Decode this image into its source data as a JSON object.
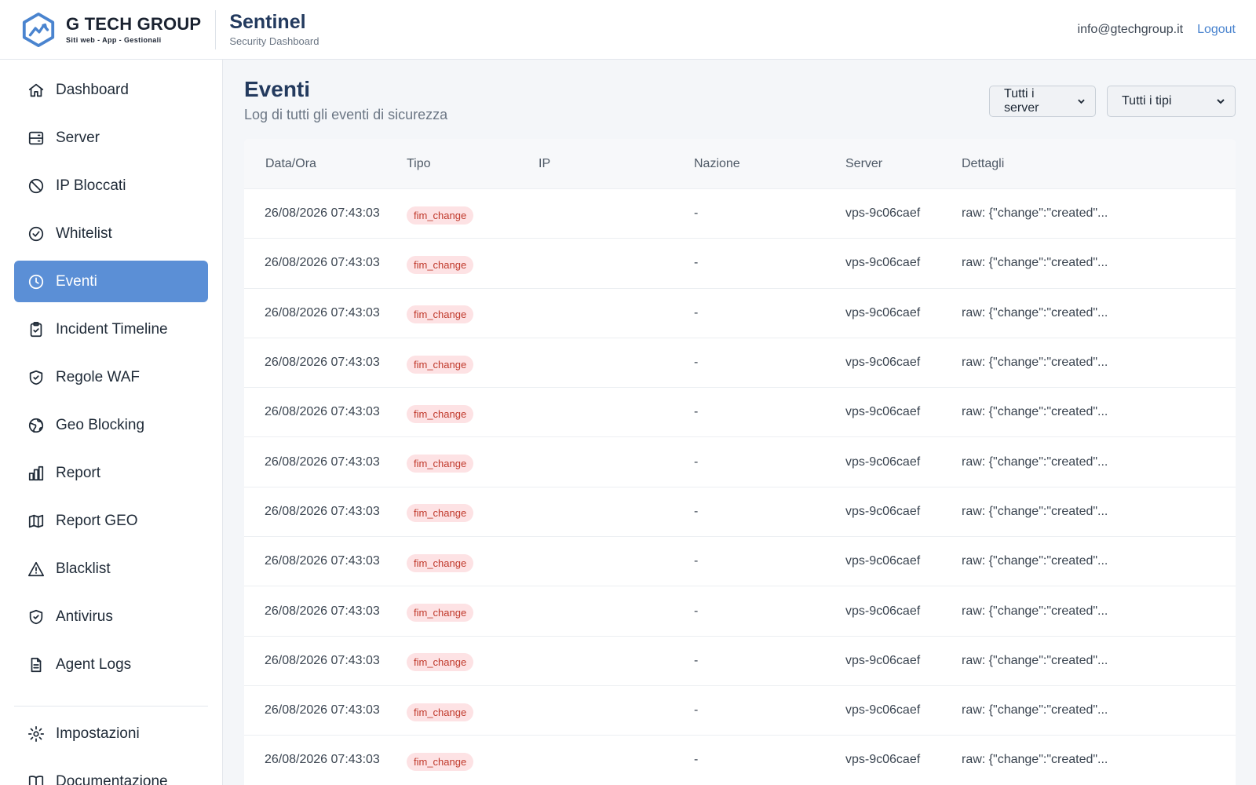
{
  "header": {
    "brand_name": "G TECH GROUP",
    "brand_tagline": "Siti web - App - Gestionali",
    "app_title": "Sentinel",
    "app_subtitle": "Security Dashboard",
    "user_email": "info@gtechgroup.it",
    "logout_label": "Logout"
  },
  "sidebar": {
    "items": [
      {
        "label": "Dashboard",
        "icon": "home-icon"
      },
      {
        "label": "Server",
        "icon": "server-icon"
      },
      {
        "label": "IP Bloccati",
        "icon": "ban-icon"
      },
      {
        "label": "Whitelist",
        "icon": "check-circle-icon"
      },
      {
        "label": "Eventi",
        "icon": "clock-icon",
        "active": true
      },
      {
        "label": "Incident Timeline",
        "icon": "clipboard-check-icon"
      },
      {
        "label": "Regole WAF",
        "icon": "shield-check-icon"
      },
      {
        "label": "Geo Blocking",
        "icon": "globe-icon"
      },
      {
        "label": "Report",
        "icon": "bar-chart-icon"
      },
      {
        "label": "Report GEO",
        "icon": "map-icon"
      },
      {
        "label": "Blacklist",
        "icon": "warning-icon"
      },
      {
        "label": "Antivirus",
        "icon": "shield-check-icon"
      },
      {
        "label": "Agent Logs",
        "icon": "document-icon"
      }
    ],
    "bottom_items": [
      {
        "label": "Impostazioni",
        "icon": "gear-icon"
      },
      {
        "label": "Documentazione",
        "icon": "book-icon"
      }
    ]
  },
  "page": {
    "title": "Eventi",
    "subtitle": "Log di tutti gli eventi di sicurezza",
    "filter_server": "Tutti i server",
    "filter_type": "Tutti i tipi"
  },
  "table": {
    "headers": {
      "date": "Data/Ora",
      "type": "Tipo",
      "ip": "IP",
      "nation": "Nazione",
      "server": "Server",
      "details": "Dettagli"
    },
    "rows": [
      {
        "date": "26/08/2026 07:43:03",
        "type": "fim_change",
        "ip": "",
        "nation": "-",
        "server": "vps-9c06caef",
        "details": "raw: {\"change\":\"created\"..."
      },
      {
        "date": "26/08/2026 07:43:03",
        "type": "fim_change",
        "ip": "",
        "nation": "-",
        "server": "vps-9c06caef",
        "details": "raw: {\"change\":\"created\"..."
      },
      {
        "date": "26/08/2026 07:43:03",
        "type": "fim_change",
        "ip": "",
        "nation": "-",
        "server": "vps-9c06caef",
        "details": "raw: {\"change\":\"created\"..."
      },
      {
        "date": "26/08/2026 07:43:03",
        "type": "fim_change",
        "ip": "",
        "nation": "-",
        "server": "vps-9c06caef",
        "details": "raw: {\"change\":\"created\"..."
      },
      {
        "date": "26/08/2026 07:43:03",
        "type": "fim_change",
        "ip": "",
        "nation": "-",
        "server": "vps-9c06caef",
        "details": "raw: {\"change\":\"created\"..."
      },
      {
        "date": "26/08/2026 07:43:03",
        "type": "fim_change",
        "ip": "",
        "nation": "-",
        "server": "vps-9c06caef",
        "details": "raw: {\"change\":\"created\"..."
      },
      {
        "date": "26/08/2026 07:43:03",
        "type": "fim_change",
        "ip": "",
        "nation": "-",
        "server": "vps-9c06caef",
        "details": "raw: {\"change\":\"created\"..."
      },
      {
        "date": "26/08/2026 07:43:03",
        "type": "fim_change",
        "ip": "",
        "nation": "-",
        "server": "vps-9c06caef",
        "details": "raw: {\"change\":\"created\"..."
      },
      {
        "date": "26/08/2026 07:43:03",
        "type": "fim_change",
        "ip": "",
        "nation": "-",
        "server": "vps-9c06caef",
        "details": "raw: {\"change\":\"created\"..."
      },
      {
        "date": "26/08/2026 07:43:03",
        "type": "fim_change",
        "ip": "",
        "nation": "-",
        "server": "vps-9c06caef",
        "details": "raw: {\"change\":\"created\"..."
      },
      {
        "date": "26/08/2026 07:43:03",
        "type": "fim_change",
        "ip": "",
        "nation": "-",
        "server": "vps-9c06caef",
        "details": "raw: {\"change\":\"created\"..."
      },
      {
        "date": "26/08/2026 07:43:03",
        "type": "fim_change",
        "ip": "",
        "nation": "-",
        "server": "vps-9c06caef",
        "details": "raw: {\"change\":\"created\"..."
      }
    ]
  },
  "colors": {
    "accent": "#5b8fd6",
    "title": "#233a5e",
    "badge_bg": "#fde2e4",
    "badge_text": "#c0392b"
  }
}
